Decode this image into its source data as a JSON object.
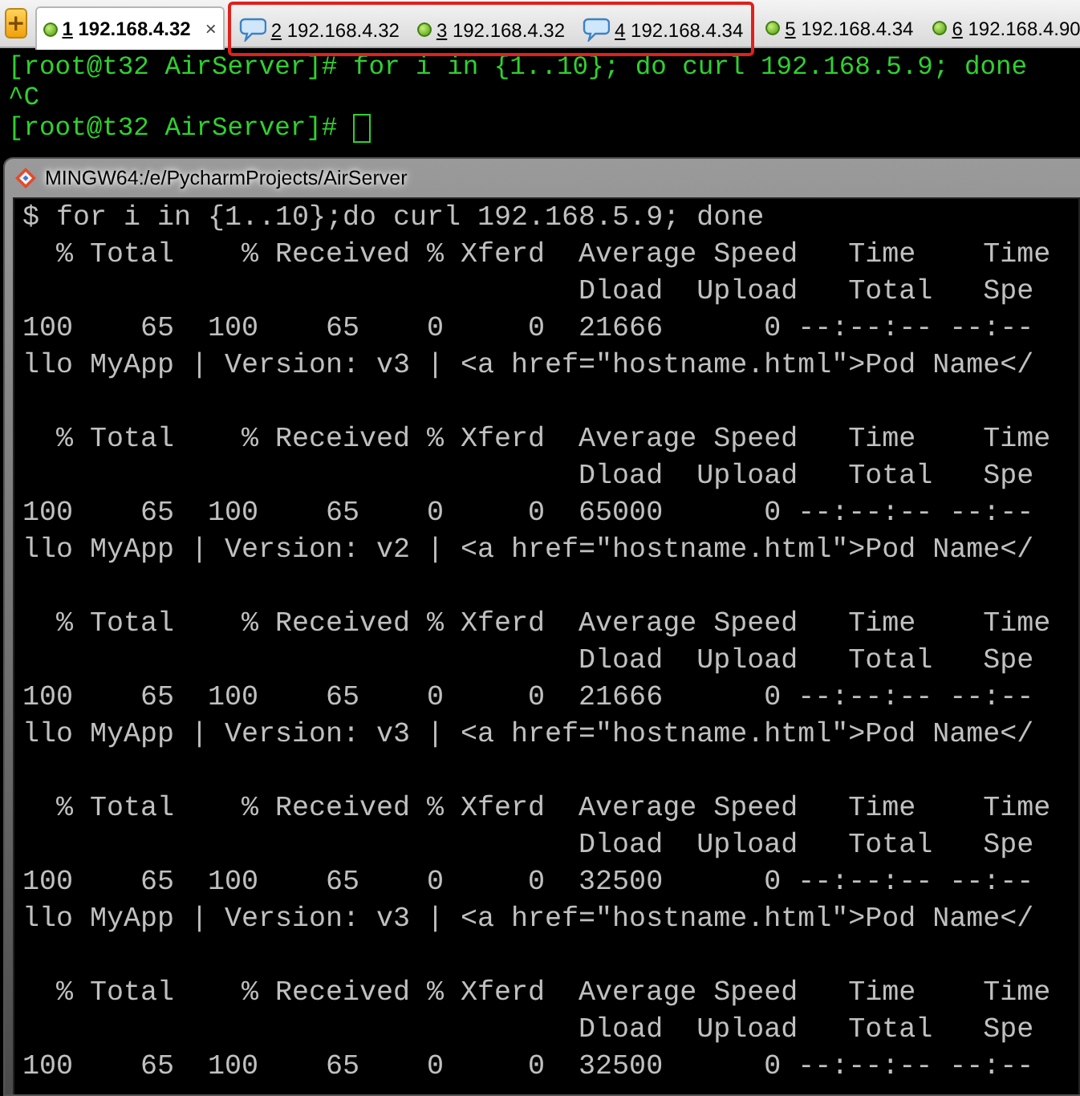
{
  "toolbar": {
    "new_tab_button": "+"
  },
  "tabs": [
    {
      "number": "1",
      "host": "192.168.4.32",
      "kind": "dot",
      "selected": true,
      "highlighted": false,
      "close": "×"
    },
    {
      "number": "2",
      "host": "192.168.4.32",
      "kind": "chat",
      "selected": false,
      "highlighted": true
    },
    {
      "number": "3",
      "host": "192.168.4.32",
      "kind": "dot",
      "selected": false,
      "highlighted": true
    },
    {
      "number": "4",
      "host": "192.168.4.34",
      "kind": "chat",
      "selected": false,
      "highlighted": true
    },
    {
      "number": "5",
      "host": "192.168.4.34",
      "kind": "dot",
      "selected": false,
      "highlighted": false
    },
    {
      "number": "6",
      "host": "192.168.4.90",
      "kind": "dot",
      "selected": false,
      "highlighted": false
    }
  ],
  "outer_terminal": {
    "lines": [
      {
        "text": "[root@t32 AirServer]# for i in {1..10}; do curl 192.168.5.9; done",
        "cursor": false
      },
      {
        "text": "^C",
        "cursor": false
      },
      {
        "text": "[root@t32 AirServer]# ",
        "cursor": true
      }
    ]
  },
  "inner_window": {
    "title": "MINGW64:/e/PycharmProjects/AirServer",
    "command": "$ for i in {1..10};do curl 192.168.5.9; done",
    "transfers": [
      {
        "header": "  % Total    % Received % Xferd  Average Speed   Time    Time",
        "subheader": "                                 Dload  Upload   Total   Spe",
        "stats": "100    65  100    65    0     0  21666      0 --:--:-- --:--",
        "output": "llo MyApp | Version: v3 | <a href=\"hostname.html\">Pod Name</"
      },
      {
        "header": "  % Total    % Received % Xferd  Average Speed   Time    Time",
        "subheader": "                                 Dload  Upload   Total   Spe",
        "stats": "100    65  100    65    0     0  65000      0 --:--:-- --:--",
        "output": "llo MyApp | Version: v2 | <a href=\"hostname.html\">Pod Name</"
      },
      {
        "header": "  % Total    % Received % Xferd  Average Speed   Time    Time",
        "subheader": "                                 Dload  Upload   Total   Spe",
        "stats": "100    65  100    65    0     0  21666      0 --:--:-- --:--",
        "output": "llo MyApp | Version: v3 | <a href=\"hostname.html\">Pod Name</"
      },
      {
        "header": "  % Total    % Received % Xferd  Average Speed   Time    Time",
        "subheader": "                                 Dload  Upload   Total   Spe",
        "stats": "100    65  100    65    0     0  32500      0 --:--:-- --:--",
        "output": "llo MyApp | Version: v3 | <a href=\"hostname.html\">Pod Name</"
      },
      {
        "header": "  % Total    % Received % Xferd  Average Speed   Time    Time",
        "subheader": "                                 Dload  Upload   Total   Spe",
        "stats": "100    65  100    65    0     0  32500      0 --:--:-- --:--"
      }
    ]
  }
}
